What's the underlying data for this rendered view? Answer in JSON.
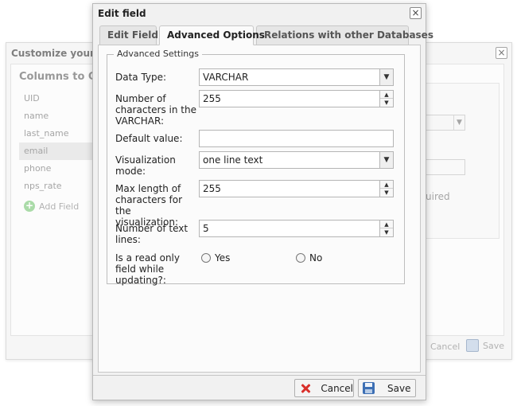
{
  "background_dialog": {
    "title": "Customize your co",
    "columns_title": "Columns to Coll",
    "columns": [
      "UID",
      "name",
      "last_name",
      "email",
      "phone",
      "nps_rate"
    ],
    "selected_column": "email",
    "add_field_label": "Add Field",
    "required_fragment": "uired",
    "cancel_label": "Cancel",
    "save_label": "Save"
  },
  "dialog": {
    "title": "Edit field",
    "close_glyph": "×",
    "tabs": [
      {
        "label": "Edit Field",
        "active": false
      },
      {
        "label": "Advanced Options",
        "active": true
      },
      {
        "label": "Relations with other Databases",
        "active": false
      }
    ],
    "legend": "Advanced Settings",
    "fields": {
      "data_type": {
        "label": "Data Type:",
        "value": "VARCHAR"
      },
      "num_chars": {
        "label": "Number of characters in the VARCHAR:",
        "value": "255"
      },
      "default_value": {
        "label": "Default value:",
        "value": ""
      },
      "visualization_mode": {
        "label": "Visualization mode:",
        "value": "one line text"
      },
      "max_length": {
        "label": "Max length of characters for the visualization:",
        "value": "255"
      },
      "text_lines": {
        "label": "Number of text lines:",
        "value": "5"
      },
      "read_only": {
        "label": "Is a read only field while updating?:",
        "yes_label": "Yes",
        "no_label": "No"
      }
    },
    "buttons": {
      "cancel": "Cancel",
      "save": "Save"
    }
  },
  "colors": {
    "dialog_bg": "#f1f1f1",
    "panel_bg": "#fbfbfb",
    "border": "#c7c7c7",
    "cancel_icon": "#d9302b",
    "save_icon": "#3d6fb4"
  },
  "icons": [
    "close-icon",
    "plus-circle-icon",
    "chevron-down-icon",
    "spinner-arrows-icon",
    "cancel-x-icon",
    "save-disk-icon"
  ]
}
